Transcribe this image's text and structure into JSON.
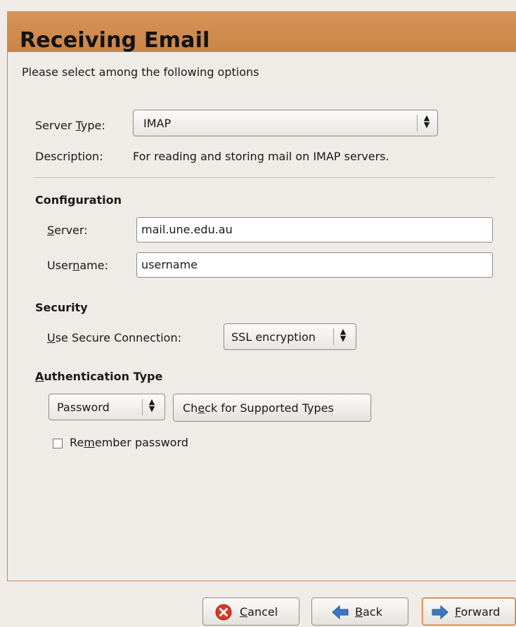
{
  "header": {
    "title": "Receiving Email"
  },
  "instructions": "Please select among the following options",
  "server_type": {
    "label_prefix": "Server ",
    "label_mnemonic": "T",
    "label_suffix": "ype:",
    "selected": "IMAP"
  },
  "description": {
    "label": "Description:",
    "text": "For reading and storing mail on IMAP servers."
  },
  "configuration": {
    "title": "Configuration",
    "server_label_mnemonic": "S",
    "server_label_rest": "erver:",
    "server_value": "mail.une.edu.au",
    "username_label_prefix": "User",
    "username_label_mnemonic": "n",
    "username_label_suffix": "ame:",
    "username_value": "username"
  },
  "security": {
    "title": "Security",
    "connection_label_mnemonic": "U",
    "connection_label_rest": "se Secure Connection:",
    "connection_selected": "SSL encryption"
  },
  "authentication": {
    "title_mnemonic": "A",
    "title_rest": "uthentication Type",
    "type_selected": "Password",
    "check_button_prefix": "Ch",
    "check_button_mnemonic": "e",
    "check_button_suffix": "ck for Supported Types",
    "remember_prefix": "Re",
    "remember_mnemonic": "m",
    "remember_suffix": "ember password",
    "remember_checked": false
  },
  "buttons": {
    "cancel_mnemonic": "C",
    "cancel_rest": "ancel",
    "back_mnemonic": "B",
    "back_rest": "ack",
    "forward_mnemonic": "F",
    "forward_rest": "orward"
  },
  "icons": {
    "cancel": "cancel-icon",
    "back": "back-arrow-icon",
    "forward": "forward-arrow-icon",
    "combo_arrows": "up-down-arrows-icon"
  },
  "colors": {
    "header_band": "#d08a4a",
    "background": "#efebe7",
    "cancel_red": "#d63a2a",
    "arrow_blue": "#3b78c4"
  }
}
